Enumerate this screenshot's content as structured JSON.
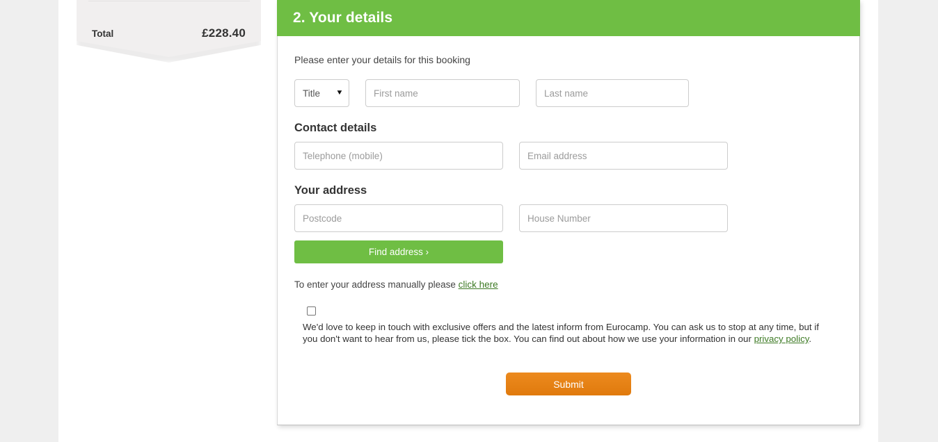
{
  "summary": {
    "total_label": "Total",
    "total_value": "£228.40"
  },
  "form": {
    "header_title": "2. Your details",
    "intro": "Please enter your details for this booking",
    "title_select": {
      "value": "Title",
      "caret": "▼"
    },
    "first_name_placeholder": "First name",
    "last_name_placeholder": "Last name",
    "contact_section_title": "Contact details",
    "telephone_placeholder": "Telephone (mobile)",
    "email_placeholder": "Email address",
    "address_section_title": "Your address",
    "postcode_placeholder": "Postcode",
    "house_number_placeholder": "House Number",
    "find_address_label": "Find address ›",
    "manual_text_before": "To enter your address manually please ",
    "manual_link": "click here",
    "consent_text_before": "We'd love to keep in touch with exclusive offers and the latest inform from Eurocamp. You can ask us to stop at any time, but if you don't want to hear from us, please tick the box. You can find out about how we use your information in our ",
    "consent_link": "privacy policy",
    "consent_text_after": ".",
    "submit_label": "Submit"
  },
  "colors": {
    "header_green": "#6FBE44",
    "button_green": "#6FBE44",
    "submit_orange": "#E8871A",
    "link_green": "#3D7A24",
    "page_background": "#EFEFEF"
  }
}
